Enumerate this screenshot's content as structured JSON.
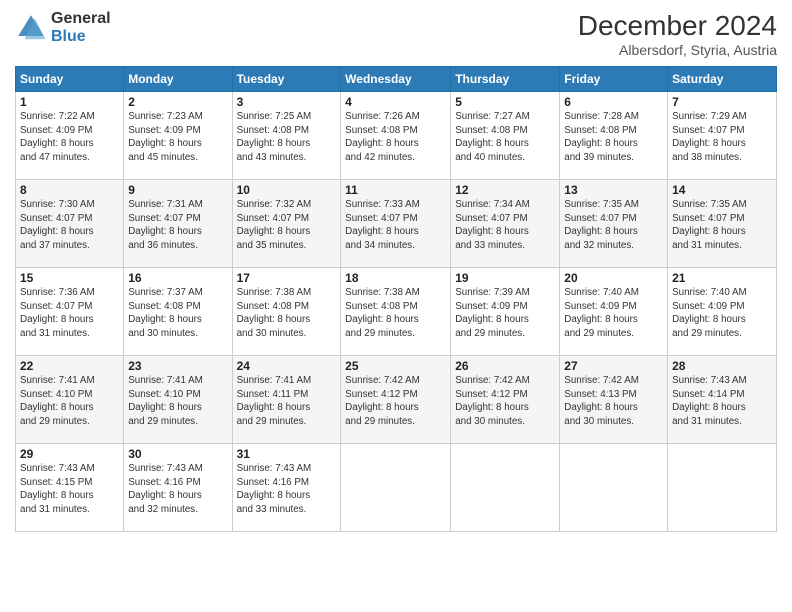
{
  "logo": {
    "line1": "General",
    "line2": "Blue"
  },
  "header": {
    "month": "December 2024",
    "location": "Albersdorf, Styria, Austria"
  },
  "days_of_week": [
    "Sunday",
    "Monday",
    "Tuesday",
    "Wednesday",
    "Thursday",
    "Friday",
    "Saturday"
  ],
  "weeks": [
    [
      {
        "day": "1",
        "sunrise": "7:22 AM",
        "sunset": "4:09 PM",
        "daylight": "8 hours and 47 minutes."
      },
      {
        "day": "2",
        "sunrise": "7:23 AM",
        "sunset": "4:09 PM",
        "daylight": "8 hours and 45 minutes."
      },
      {
        "day": "3",
        "sunrise": "7:25 AM",
        "sunset": "4:08 PM",
        "daylight": "8 hours and 43 minutes."
      },
      {
        "day": "4",
        "sunrise": "7:26 AM",
        "sunset": "4:08 PM",
        "daylight": "8 hours and 42 minutes."
      },
      {
        "day": "5",
        "sunrise": "7:27 AM",
        "sunset": "4:08 PM",
        "daylight": "8 hours and 40 minutes."
      },
      {
        "day": "6",
        "sunrise": "7:28 AM",
        "sunset": "4:08 PM",
        "daylight": "8 hours and 39 minutes."
      },
      {
        "day": "7",
        "sunrise": "7:29 AM",
        "sunset": "4:07 PM",
        "daylight": "8 hours and 38 minutes."
      }
    ],
    [
      {
        "day": "8",
        "sunrise": "7:30 AM",
        "sunset": "4:07 PM",
        "daylight": "8 hours and 37 minutes."
      },
      {
        "day": "9",
        "sunrise": "7:31 AM",
        "sunset": "4:07 PM",
        "daylight": "8 hours and 36 minutes."
      },
      {
        "day": "10",
        "sunrise": "7:32 AM",
        "sunset": "4:07 PM",
        "daylight": "8 hours and 35 minutes."
      },
      {
        "day": "11",
        "sunrise": "7:33 AM",
        "sunset": "4:07 PM",
        "daylight": "8 hours and 34 minutes."
      },
      {
        "day": "12",
        "sunrise": "7:34 AM",
        "sunset": "4:07 PM",
        "daylight": "8 hours and 33 minutes."
      },
      {
        "day": "13",
        "sunrise": "7:35 AM",
        "sunset": "4:07 PM",
        "daylight": "8 hours and 32 minutes."
      },
      {
        "day": "14",
        "sunrise": "7:35 AM",
        "sunset": "4:07 PM",
        "daylight": "8 hours and 31 minutes."
      }
    ],
    [
      {
        "day": "15",
        "sunrise": "7:36 AM",
        "sunset": "4:07 PM",
        "daylight": "8 hours and 31 minutes."
      },
      {
        "day": "16",
        "sunrise": "7:37 AM",
        "sunset": "4:08 PM",
        "daylight": "8 hours and 30 minutes."
      },
      {
        "day": "17",
        "sunrise": "7:38 AM",
        "sunset": "4:08 PM",
        "daylight": "8 hours and 30 minutes."
      },
      {
        "day": "18",
        "sunrise": "7:38 AM",
        "sunset": "4:08 PM",
        "daylight": "8 hours and 29 minutes."
      },
      {
        "day": "19",
        "sunrise": "7:39 AM",
        "sunset": "4:09 PM",
        "daylight": "8 hours and 29 minutes."
      },
      {
        "day": "20",
        "sunrise": "7:40 AM",
        "sunset": "4:09 PM",
        "daylight": "8 hours and 29 minutes."
      },
      {
        "day": "21",
        "sunrise": "7:40 AM",
        "sunset": "4:09 PM",
        "daylight": "8 hours and 29 minutes."
      }
    ],
    [
      {
        "day": "22",
        "sunrise": "7:41 AM",
        "sunset": "4:10 PM",
        "daylight": "8 hours and 29 minutes."
      },
      {
        "day": "23",
        "sunrise": "7:41 AM",
        "sunset": "4:10 PM",
        "daylight": "8 hours and 29 minutes."
      },
      {
        "day": "24",
        "sunrise": "7:41 AM",
        "sunset": "4:11 PM",
        "daylight": "8 hours and 29 minutes."
      },
      {
        "day": "25",
        "sunrise": "7:42 AM",
        "sunset": "4:12 PM",
        "daylight": "8 hours and 29 minutes."
      },
      {
        "day": "26",
        "sunrise": "7:42 AM",
        "sunset": "4:12 PM",
        "daylight": "8 hours and 30 minutes."
      },
      {
        "day": "27",
        "sunrise": "7:42 AM",
        "sunset": "4:13 PM",
        "daylight": "8 hours and 30 minutes."
      },
      {
        "day": "28",
        "sunrise": "7:43 AM",
        "sunset": "4:14 PM",
        "daylight": "8 hours and 31 minutes."
      }
    ],
    [
      {
        "day": "29",
        "sunrise": "7:43 AM",
        "sunset": "4:15 PM",
        "daylight": "8 hours and 31 minutes."
      },
      {
        "day": "30",
        "sunrise": "7:43 AM",
        "sunset": "4:16 PM",
        "daylight": "8 hours and 32 minutes."
      },
      {
        "day": "31",
        "sunrise": "7:43 AM",
        "sunset": "4:16 PM",
        "daylight": "8 hours and 33 minutes."
      },
      null,
      null,
      null,
      null
    ]
  ]
}
